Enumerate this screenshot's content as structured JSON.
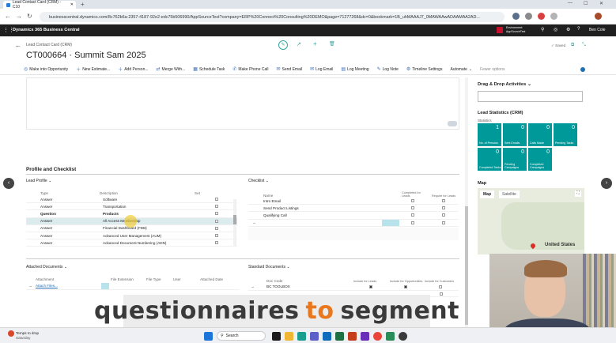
{
  "browser": {
    "tab_title": "Lead Contact Card (CRM) - C10",
    "url": "businesscentral.dynamics.com/8c762b6a-2357-4187-92e2-edc75b506990/AppSourceTest?company=ERP%20Connect%20Consulting%20DEMO&page=71277268&dc=0&bookmark=1B_uhMAAAJ7_0MAWAAwADAAMAA2AD...",
    "tab_plus": "+",
    "back": "←",
    "forward": "→",
    "reload": "↻"
  },
  "app": {
    "name": "Dynamics 365 Business Central",
    "environment_line1": "Environment:",
    "environment_line2": "AppSourceTest",
    "user": "Ben Cole"
  },
  "page": {
    "breadcrumb": "Lead Contact Card (CRM)",
    "title": "CT000664 · Summit Sam 2025",
    "saved": "✓ Saved"
  },
  "actions": [
    {
      "label": "Make into Opportunity"
    },
    {
      "label": "New Estimate..."
    },
    {
      "label": "Add Person..."
    },
    {
      "label": "Merge With..."
    },
    {
      "label": "Schedule Task"
    },
    {
      "label": "Make Phone Call"
    },
    {
      "label": "Send Email"
    },
    {
      "label": "Log Email"
    },
    {
      "label": "Log Meeting"
    },
    {
      "label": "Log Note"
    },
    {
      "label": "Timeline Settings"
    },
    {
      "label": "Automate"
    },
    {
      "label": "Fewer options"
    }
  ],
  "sections": {
    "profile_checklist": "Profile and Checklist",
    "lead_profile": "Lead Profile",
    "checklist": "Checklist",
    "attached_documents": "Attached Documents",
    "standard_documents": "Standard Documents"
  },
  "lead_profile": {
    "headers": {
      "type": "Type",
      "description": "Description",
      "set": "Set"
    },
    "rows": [
      {
        "type": "Answer",
        "description": "Software",
        "bold": false
      },
      {
        "type": "Answer",
        "description": "Transportation",
        "bold": false
      },
      {
        "type": "Question",
        "description": "Products",
        "bold": true
      },
      {
        "type": "Answer",
        "description": "All Access Membership",
        "bold": false
      },
      {
        "type": "Answer",
        "description": "Financial Dashboard (FDB)",
        "bold": false
      },
      {
        "type": "Answer",
        "description": "Advanced User Management (AUM)",
        "bold": false
      },
      {
        "type": "Answer",
        "description": "Advanced Document Numbering (ADN)",
        "bold": false
      }
    ]
  },
  "checklist_table": {
    "headers": {
      "name": "Name",
      "completed": "Completed for Leads",
      "required": "Require for Leads"
    },
    "rows": [
      {
        "name": "Intro Email"
      },
      {
        "name": "Send Product Listings"
      },
      {
        "name": "Qualifying Call"
      },
      {
        "name": ""
      }
    ]
  },
  "attached_table": {
    "headers": {
      "attachment": "Attachment",
      "ext": "File Extension",
      "ftype": "File Type",
      "user": "User",
      "date": "Attached Date"
    },
    "first_row": "Attach Files..."
  },
  "standard_table": {
    "headers": {
      "doc": "Doc Code",
      "leads": "Include for Leads",
      "opps": "Include for Opportunities",
      "cust": "Include for Customers"
    },
    "first_row": "BC TOOLBOX"
  },
  "factbox": {
    "drag_drop": "Drag & Drop Activities",
    "lead_stats": "Lead Statistics (CRM)",
    "statistics": "Statistics",
    "tiles": [
      {
        "value": "1",
        "label": "No. of Persons"
      },
      {
        "value": "0",
        "label": "Sent Emails"
      },
      {
        "value": "0",
        "label": "Calls Made"
      },
      {
        "value": "0",
        "label": "Pending Tasks"
      },
      {
        "value": "0",
        "label": "Completed Tasks"
      },
      {
        "value": "0",
        "label": "Pending Campaigns"
      },
      {
        "value": "0",
        "label": "Completed Campaigns"
      }
    ],
    "map_title": "Map",
    "map_tab": "Map",
    "satellite_tab": "Satellite",
    "map_country": "United States"
  },
  "caption": {
    "part1": "questionnaires",
    "part2": "to",
    "part3": "segment"
  },
  "taskbar": {
    "weather_temp": "Temps to drop",
    "weather_day": "Saturday",
    "search": "Search"
  },
  "colors": {
    "accent": "#009999",
    "appbar": "#1f1f1f",
    "highlight": "#e8771e"
  }
}
